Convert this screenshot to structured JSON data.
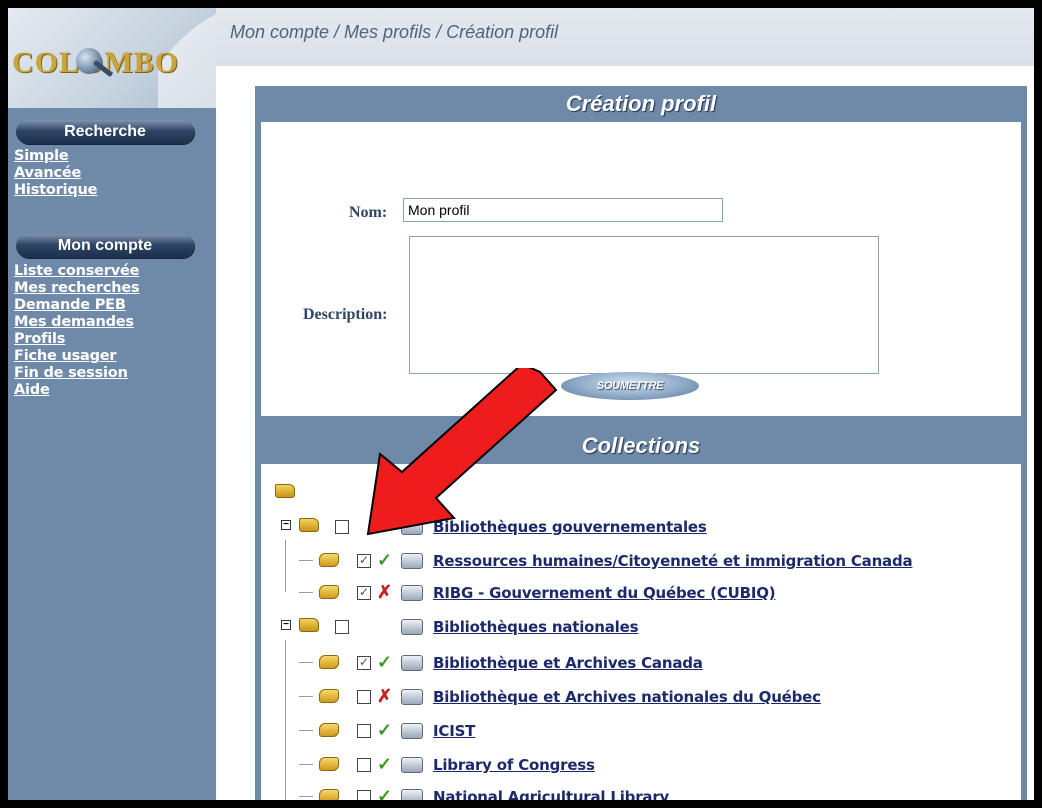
{
  "logo": {
    "text": "COLOMBO"
  },
  "breadcrumb": "Mon compte / Mes profils / Création profil",
  "sidebar": {
    "search_header": "Recherche",
    "search_links": [
      "Simple",
      "Avancée",
      "Historique"
    ],
    "account_header": "Mon compte",
    "account_links": [
      "Liste conservée",
      "Mes recherches",
      "Demande PEB",
      "Mes demandes",
      "Profils",
      "Fiche usager",
      "Fin de session",
      "Aide"
    ]
  },
  "form": {
    "title": "Création profil",
    "name_label": "Nom:",
    "name_value": "Mon profil",
    "description_label": "Description:",
    "description_value": "",
    "submit_label": "SOUMETTRE"
  },
  "collections": {
    "title": "Collections",
    "groups": [
      {
        "label": "Bibliothèques gouvernementales",
        "checked": false,
        "items": [
          {
            "label": "Ressources humaines/Citoyenneté et immigration Canada",
            "checked": true,
            "status": "ok"
          },
          {
            "label": "RIBG - Gouvernement du Québec (CUBIQ)",
            "checked": true,
            "status": "unavailable"
          }
        ]
      },
      {
        "label": "Bibliothèques nationales",
        "checked": false,
        "items": [
          {
            "label": "Bibliothèque et Archives Canada",
            "checked": true,
            "status": "ok"
          },
          {
            "label": "Bibliothèque et Archives nationales du Québec",
            "checked": false,
            "status": "unavailable"
          },
          {
            "label": "ICIST",
            "checked": false,
            "status": "ok"
          },
          {
            "label": "Library of Congress",
            "checked": false,
            "status": "ok"
          },
          {
            "label": "National Agricultural Library",
            "checked": false,
            "status": "ok"
          }
        ]
      }
    ]
  },
  "icons": {
    "ok": "check-icon",
    "unavailable": "x-icon",
    "folder": "folder-icon",
    "resource": "scroll-icon",
    "search": "search-icon"
  },
  "colors": {
    "panel": "#6f8aa8",
    "link": "#1c2a6a",
    "arrow": "#ee1c1c"
  }
}
